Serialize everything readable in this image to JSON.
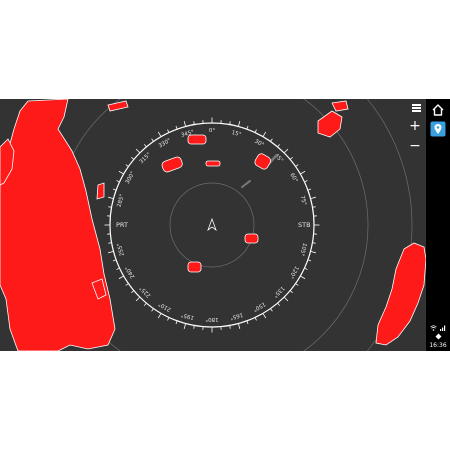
{
  "radar": {
    "heading_labels": [
      "345°",
      "0°",
      "15°",
      "30°",
      "45°",
      "60°",
      "75°",
      "105°",
      "120°",
      "135°",
      "150°",
      "165°",
      "180°",
      "195°",
      "210°",
      "225°",
      "240°",
      "255°",
      "285°",
      "300°",
      "315°",
      "330°"
    ],
    "heading_values": [
      345,
      0,
      15,
      30,
      45,
      60,
      75,
      105,
      120,
      135,
      150,
      165,
      180,
      195,
      210,
      225,
      240,
      255,
      285,
      300,
      315,
      330
    ],
    "port_label": "PRT",
    "starboard_label": "STB",
    "echo_color": "#ff1a1a",
    "background_color": "#333333"
  },
  "toolbar": {
    "menu_icon": "menu-icon",
    "zoom_in_label": "+",
    "zoom_out_label": "−"
  },
  "sidebar": {
    "home_icon": "home-icon",
    "location_icon": "location-pin-icon"
  },
  "status": {
    "time": "16:36"
  }
}
